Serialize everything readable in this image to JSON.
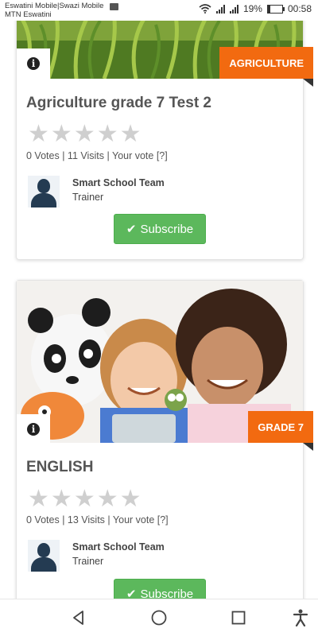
{
  "status_bar": {
    "carrier_line1": "Eswatini Mobile|Swazi Mobile",
    "carrier_line2": "MTN Eswatini",
    "battery": "19%",
    "battery_level": 0.19,
    "time": "00:58"
  },
  "cards": [
    {
      "badge": "AGRICULTURE",
      "title": "Agriculture grade 7 Test 2",
      "rating": 0,
      "votes": "0 Votes",
      "visits": "11 Visits",
      "your_vote": "Your vote [?]",
      "trainer_name": "Smart School Team",
      "trainer_role": "Trainer",
      "subscribe": "Subscribe"
    },
    {
      "badge": "GRADE 7",
      "title": "ENGLISH",
      "rating": 0,
      "votes": "0 Votes",
      "visits": "13 Visits",
      "your_vote": "Your vote [?]",
      "trainer_name": "Smart School Team",
      "trainer_role": "Trainer",
      "subscribe": "Subscribe"
    }
  ],
  "separator": "|",
  "icons": [
    "info-icon",
    "star-icon",
    "check-icon",
    "back-icon",
    "home-icon",
    "recents-icon",
    "accessibility-icon",
    "wifi-icon",
    "signal-icon",
    "battery-icon",
    "image-icon"
  ],
  "colors": {
    "badge": "#f26a10",
    "subscribe": "#5cb85c",
    "avatar": "#243b52"
  }
}
